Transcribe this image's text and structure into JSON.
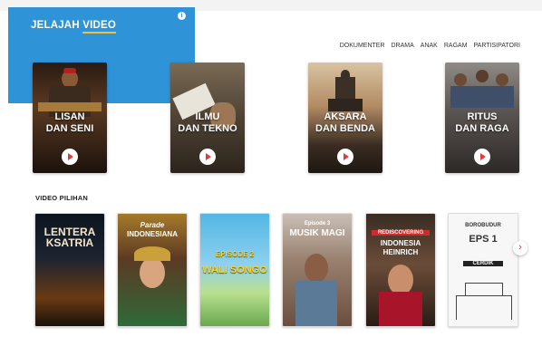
{
  "header": {
    "title_prefix": "JELAJAH ",
    "title_highlight": "VIDEO",
    "info_icon": "info-icon"
  },
  "categories": [
    "DOKUMENTER",
    "DRAMA",
    "ANAK",
    "RAGAM",
    "PARTISIPATORI"
  ],
  "topics": [
    {
      "label": "LISAN\nDAN SENI"
    },
    {
      "label": "ILMU\nDAN TEKNO"
    },
    {
      "label": "AKSARA\nDAN BENDA"
    },
    {
      "label": "RITUS\nDAN RAGA"
    }
  ],
  "section": {
    "title": "VIDEO PILIHAN"
  },
  "videos": [
    {
      "line1": "LENTERA",
      "line2": "KSATRIA"
    },
    {
      "line1": "Parade",
      "line2": "INDONESIANA"
    },
    {
      "line1": "EPISODE 2",
      "line2": "WALI SONGO"
    },
    {
      "line1": "Episode 3",
      "line2": "MUSIK MAGI"
    },
    {
      "line1": "REDISCOVERING",
      "line2": "INDONESIA HEINRICH"
    },
    {
      "line1": "BOROBUDUR",
      "line2": "EPS 1",
      "line3": "CERDIK"
    }
  ],
  "controls": {
    "next": "›",
    "prev": "‹"
  },
  "colors": {
    "accent": "#2f93d8",
    "underline": "#f2c230",
    "play": "#e53935"
  }
}
